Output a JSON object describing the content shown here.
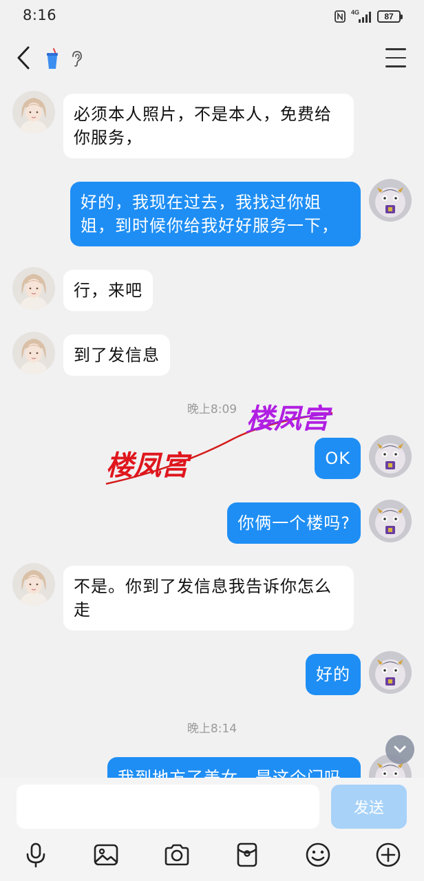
{
  "status_bar": {
    "time": "8:16",
    "network": "4G",
    "battery": "87"
  },
  "nav": {
    "back_icon": "chevron-left-icon",
    "menu_icon": "hamburger-menu-icon"
  },
  "messages": [
    {
      "side": "left",
      "text": "必须本人照片，不是本人，免费给你服务，"
    },
    {
      "side": "right",
      "text": "好的，我现在过去，我找过你姐姐，到时候你给我好好服务一下，"
    },
    {
      "side": "left",
      "text": "行，来吧"
    },
    {
      "side": "left",
      "text": "到了发信息"
    },
    {
      "type": "time",
      "text": "晚上8:09"
    },
    {
      "side": "right",
      "text": "OK"
    },
    {
      "side": "right",
      "text": "你俩一个楼吗?"
    },
    {
      "side": "left",
      "text": "不是。你到了发信息我告诉你怎么走"
    },
    {
      "side": "right",
      "text": "好的"
    },
    {
      "type": "time",
      "text": "晚上8:14"
    },
    {
      "side": "right",
      "text": "我到地方了美女，是这个门吗"
    }
  ],
  "watermark": {
    "text_1": "楼凤宫",
    "text_2": "楼凤宫"
  },
  "input": {
    "placeholder": "",
    "send_label": "发送"
  },
  "toolbar": [
    "microphone-icon",
    "image-icon",
    "camera-icon",
    "red-packet-icon",
    "emoji-icon",
    "plus-icon"
  ],
  "colors": {
    "sent_bubble": "#1e8ef4",
    "received_bubble": "#ffffff",
    "background": "#f1f1f2",
    "send_button": "#a8d2f8"
  }
}
